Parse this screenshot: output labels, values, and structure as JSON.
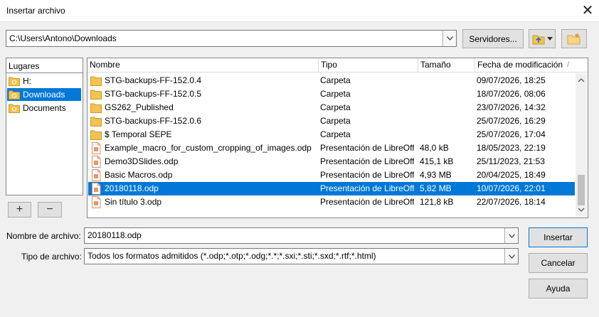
{
  "window": {
    "title": "Insertar archivo",
    "close_label": "✕"
  },
  "toolbar": {
    "path": "C:\\Users\\Antono\\Downloads",
    "servers_label": "Servidores..."
  },
  "places": {
    "header": "Lugares",
    "items": [
      {
        "label": "H:"
      },
      {
        "label": "Downloads"
      },
      {
        "label": "Documents"
      }
    ],
    "add_label": "+",
    "remove_label": "−"
  },
  "files": {
    "columns": {
      "name": "Nombre",
      "type": "Tipo",
      "size": "Tamaño",
      "modified": "Fecha de modificación"
    },
    "sort_indicator": "/",
    "rows": [
      {
        "name": "STG-backups-FF-152.0.4",
        "type": "Carpeta",
        "size": "",
        "modified": "09/07/2026, 18:25",
        "icon": "folder-icon"
      },
      {
        "name": "STG-backups-FF-152.0.5",
        "type": "Carpeta",
        "size": "",
        "modified": "18/07/2026, 08:06",
        "icon": "folder-icon"
      },
      {
        "name": "GS262_Published",
        "type": "Carpeta",
        "size": "",
        "modified": "23/07/2026, 14:32",
        "icon": "folder-icon"
      },
      {
        "name": "STG-backups-FF-152.0.6",
        "type": "Carpeta",
        "size": "",
        "modified": "25/07/2026, 16:29",
        "icon": "folder-icon"
      },
      {
        "name": "$ Temporal SEPE",
        "type": "Carpeta",
        "size": "",
        "modified": "25/07/2026, 17:04",
        "icon": "folder-icon"
      },
      {
        "name": "Example_macro_for_custom_cropping_of_images.odp",
        "type": "Presentación de LibreOff",
        "size": "48,0 kB",
        "modified": "18/05/2023, 22:19",
        "icon": "document-icon"
      },
      {
        "name": "Demo3DSlides.odp",
        "type": "Presentación de LibreOff",
        "size": "415,1 kB",
        "modified": "25/11/2023, 21:53",
        "icon": "document-icon"
      },
      {
        "name": "Basic Macros.odp",
        "type": "Presentación de LibreOff",
        "size": "4,93 MB",
        "modified": "20/04/2025, 18:49",
        "icon": "document-icon"
      },
      {
        "name": "20180118.odp",
        "type": "Presentación de LibreOff",
        "size": "5,82 MB",
        "modified": "10/07/2026, 22:01",
        "icon": "document-icon"
      },
      {
        "name": "Sin título 3.odp",
        "type": "Presentación de LibreOff",
        "size": "121,8 kB",
        "modified": "22/07/2026, 18:14",
        "icon": "document-icon"
      }
    ]
  },
  "form": {
    "filename_label": "Nombre de archivo:",
    "filename_value": "20180118.odp",
    "filetype_label": "Tipo de archivo:",
    "filetype_value": "Todos los formatos admitidos (*.odp;*.otp;*.odg;*.*;*.sxi;*.sti;*.sxd;*.rtf;*.html)"
  },
  "buttons": {
    "insert": "Insertar",
    "cancel": "Cancelar",
    "help": "Ayuda"
  },
  "colors": {
    "selection": "#0078d7",
    "folder": "#f4c24e"
  }
}
